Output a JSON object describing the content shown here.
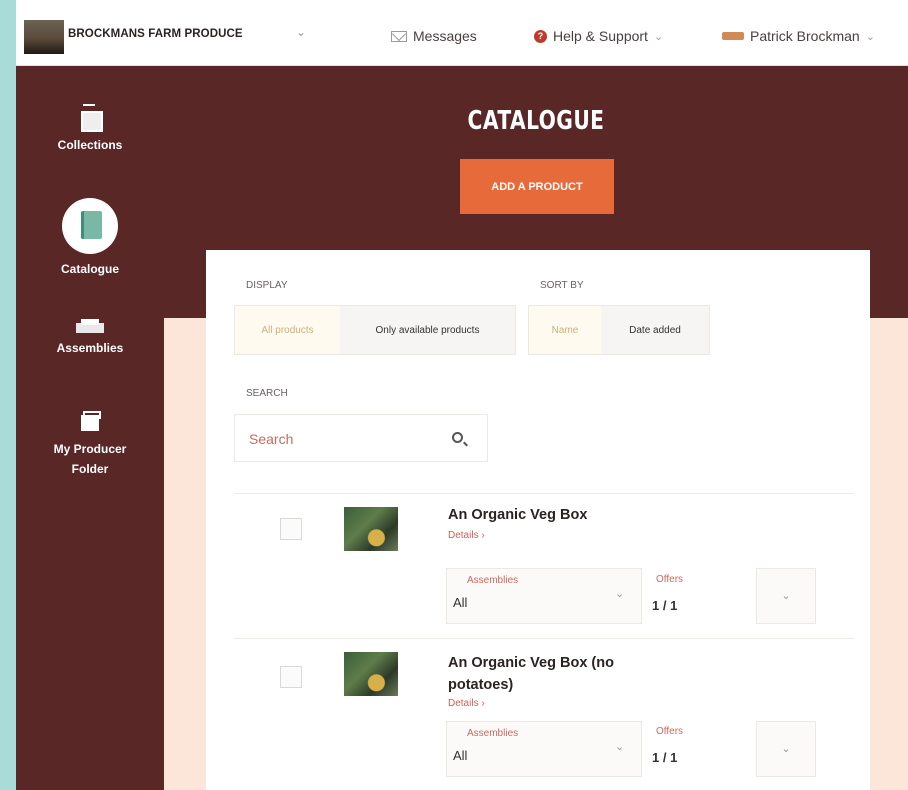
{
  "topbar": {
    "brand_name": "BROCKMANS FARM PRODUCE",
    "brand_chevron": "⌄",
    "messages_label": "Messages",
    "help_label": "Help & Support",
    "help_chevron": "⌄",
    "user_name": "Patrick Brockman",
    "user_chevron": "⌄"
  },
  "sidebar": {
    "items": [
      {
        "label": "Collections",
        "icon": "collections-icon"
      },
      {
        "label": "Catalogue",
        "icon": "catalogue-icon",
        "active": true
      },
      {
        "label": "Assemblies",
        "icon": "assemblies-icon"
      },
      {
        "label": "My Producer Folder",
        "icon": "folder-icon"
      }
    ]
  },
  "header": {
    "title": "CATALOGUE",
    "add_button": "ADD A PRODUCT"
  },
  "filters": {
    "display_label": "DISPLAY",
    "display_options": [
      "All products",
      "Only available products"
    ],
    "display_selected": "All products",
    "sort_label": "SORT BY",
    "sort_options": [
      "Name",
      "Date added"
    ],
    "sort_selected": "Name",
    "search_label": "SEARCH",
    "search_placeholder": "Search"
  },
  "products": [
    {
      "title": "An Organic Veg Box",
      "details": "Details ›",
      "assemblies_label": "Assemblies",
      "assemblies_value": "All",
      "offers_label": "Offers",
      "offers_value": "1 / 1"
    },
    {
      "title": "An Organic Veg Box (no potatoes)",
      "details": "Details ›",
      "assemblies_label": "Assemblies",
      "assemblies_value": "All",
      "offers_label": "Offers",
      "offers_value": "1 / 1"
    }
  ],
  "colors": {
    "sidebar_bg": "#5a2727",
    "accent_orange": "#e76b3a",
    "panel_bg": "#ffffff",
    "page_bg": "#fbe6d9"
  }
}
